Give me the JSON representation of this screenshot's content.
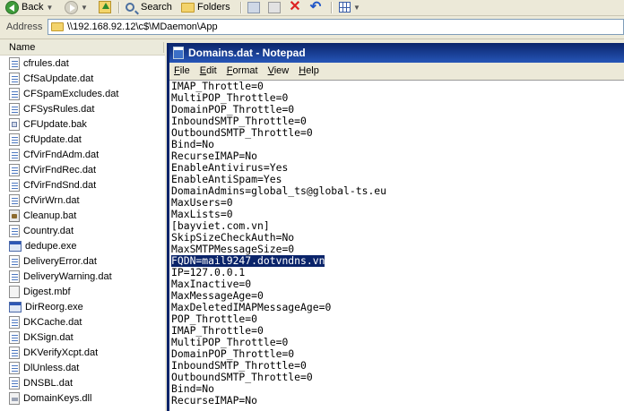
{
  "toolbar": {
    "back": "Back",
    "search": "Search",
    "folders": "Folders"
  },
  "address": {
    "label": "Address",
    "path": "\\\\192.168.92.12\\c$\\MDaemon\\App"
  },
  "filelist": {
    "column": "Name",
    "files": [
      {
        "name": "cfrules.dat",
        "icon": "txt"
      },
      {
        "name": "CfSaUpdate.dat",
        "icon": "txt"
      },
      {
        "name": "CFSpamExcludes.dat",
        "icon": "txt"
      },
      {
        "name": "CFSysRules.dat",
        "icon": "txt"
      },
      {
        "name": "CFUpdate.bak",
        "icon": "bak"
      },
      {
        "name": "CfUpdate.dat",
        "icon": "txt"
      },
      {
        "name": "CfVirFndAdm.dat",
        "icon": "txt"
      },
      {
        "name": "CfVirFndRec.dat",
        "icon": "txt"
      },
      {
        "name": "CfVirFndSnd.dat",
        "icon": "txt"
      },
      {
        "name": "CfVirWrn.dat",
        "icon": "txt"
      },
      {
        "name": "Cleanup.bat",
        "icon": "bat"
      },
      {
        "name": "Country.dat",
        "icon": "txt"
      },
      {
        "name": "dedupe.exe",
        "icon": "exe"
      },
      {
        "name": "DeliveryError.dat",
        "icon": "txt"
      },
      {
        "name": "DeliveryWarning.dat",
        "icon": "txt"
      },
      {
        "name": "Digest.mbf",
        "icon": "mbf"
      },
      {
        "name": "DirReorg.exe",
        "icon": "exe"
      },
      {
        "name": "DKCache.dat",
        "icon": "txt"
      },
      {
        "name": "DKSign.dat",
        "icon": "txt"
      },
      {
        "name": "DKVerifyXcpt.dat",
        "icon": "txt"
      },
      {
        "name": "DlUnless.dat",
        "icon": "txt"
      },
      {
        "name": "DNSBL.dat",
        "icon": "txt"
      },
      {
        "name": "DomainKeys.dll",
        "icon": "dll"
      }
    ]
  },
  "notepad": {
    "title": "Domains.dat - Notepad",
    "menu": [
      "File",
      "Edit",
      "Format",
      "View",
      "Help"
    ],
    "selected_line": 15,
    "lines": [
      "IMAP_Throttle=0",
      "MultiPOP_Throttle=0",
      "DomainPOP_Throttle=0",
      "InboundSMTP_Throttle=0",
      "OutboundSMTP_Throttle=0",
      "Bind=No",
      "RecurseIMAP=No",
      "EnableAntivirus=Yes",
      "EnableAntiSpam=Yes",
      "DomainAdmins=global_ts@global-ts.eu",
      "MaxUsers=0",
      "MaxLists=0",
      "[bayviet.com.vn]",
      "SkipSizeCheckAuth=No",
      "MaxSMTPMessageSize=0",
      "FQDN=mail9247.dotvndns.vn",
      "IP=127.0.0.1",
      "MaxInactive=0",
      "MaxMessageAge=0",
      "MaxDeletedIMAPMessageAge=0",
      "POP_Throttle=0",
      "IMAP_Throttle=0",
      "MultiPOP_Throttle=0",
      "DomainPOP_Throttle=0",
      "InboundSMTP_Throttle=0",
      "OutboundSMTP_Throttle=0",
      "Bind=No",
      "RecurseIMAP=No"
    ]
  }
}
